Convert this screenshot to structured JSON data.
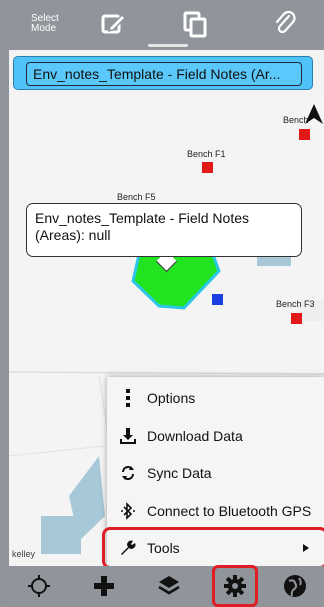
{
  "toolbar": {
    "select_mode_label": "Select Mode",
    "icons": [
      "edit-icon",
      "copy-icon",
      "paperclip-icon"
    ]
  },
  "layer_selector": {
    "value": "Env_notes_Template - Field Notes (Ar..."
  },
  "map": {
    "bench_labels": [
      "Bench F1",
      "Bench F5",
      "Bench F3",
      "Bench"
    ],
    "callout_text": "Env_notes_Template - Field Notes (Areas): null",
    "attribution": "kelley",
    "colors": {
      "polygon_fill": "#22e31f",
      "polygon_outline": "#2bc7e8",
      "bench_point": "#e11818",
      "selected_point": "#1a3fe0",
      "water": "#a7c8d6"
    }
  },
  "menu": {
    "items": [
      {
        "label": "Options",
        "icon": "more-vertical-icon"
      },
      {
        "label": "Download Data",
        "icon": "download-icon"
      },
      {
        "label": "Sync Data",
        "icon": "sync-icon"
      },
      {
        "label": "Connect to Bluetooth GPS",
        "icon": "bluetooth-icon"
      },
      {
        "label": "Tools",
        "icon": "wrench-icon",
        "has_submenu": true
      }
    ],
    "highlight_color": "#e01c24"
  },
  "bottom_bar": {
    "icons": [
      "gps-target-icon",
      "add-icon",
      "layers-icon",
      "gear-icon",
      "globe-icon"
    ]
  }
}
